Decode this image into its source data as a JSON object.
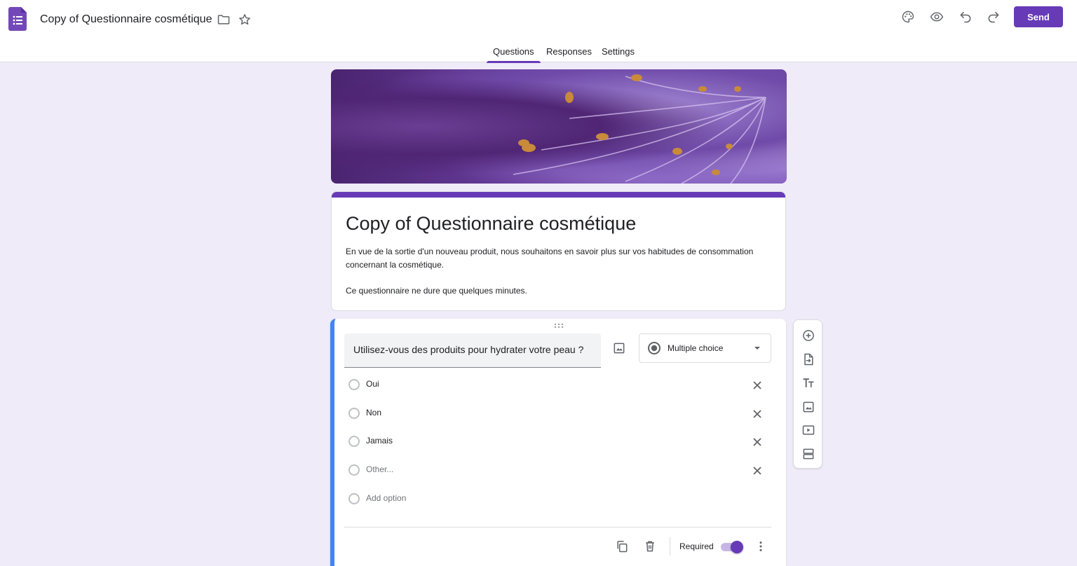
{
  "header": {
    "doc_title": "Copy of Questionnaire cosmétique",
    "send_label": "Send",
    "icons": [
      "forms-logo-icon",
      "folder-icon",
      "star-icon",
      "palette-icon",
      "preview-eye-icon",
      "undo-icon",
      "redo-icon"
    ]
  },
  "tabs": [
    {
      "label": "Questions",
      "active": true
    },
    {
      "label": "Responses",
      "active": false
    },
    {
      "label": "Settings",
      "active": false
    }
  ],
  "form": {
    "title": "Copy of Questionnaire cosmétique",
    "description_1": "En vue de la sortie d'un nouveau produit, nous souhaitons en savoir plus sur vos habitudes de consommation concernant la cosmétique.",
    "description_2": "Ce questionnaire ne dure que quelques minutes."
  },
  "question": {
    "text": "Utilisez-vous des produits pour hydrater votre peau ?",
    "type": "Multiple choice",
    "options": [
      "Oui",
      "Non",
      "Jamais"
    ],
    "other_label": "Other...",
    "add_option_label": "Add option",
    "required_label": "Required",
    "required": true
  },
  "side_toolbar": {
    "icons": [
      "add-question-icon",
      "import-questions-icon",
      "add-title-icon",
      "add-image-icon",
      "add-video-icon",
      "add-section-icon"
    ]
  },
  "colors": {
    "accent": "#673ab7",
    "background": "#f0ebf8",
    "active_card_border": "#4285f4"
  }
}
